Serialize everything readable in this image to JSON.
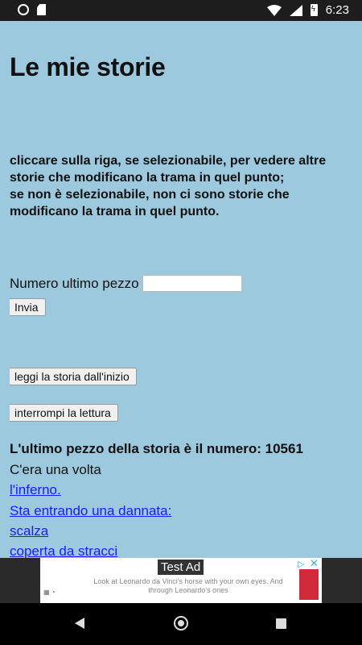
{
  "status": {
    "time": "6:23"
  },
  "page": {
    "title": "Le mie storie",
    "instructions": [
      "cliccare sulla riga, se selezionabile, per vedere altre storie che modificano la trama in quel punto;",
      "se non è selezionabile, non ci sono storie che modificano la trama in quel punto."
    ],
    "form": {
      "label": "Numero ultimo pezzo",
      "value": "",
      "submit": "Invia"
    },
    "buttons": {
      "start": "leggi la storia dall'inizio",
      "stop": "interrompi la lettura"
    },
    "last_piece": "L'ultimo pezzo della storia è il numero: 10561",
    "story": [
      {
        "text": "C'era una volta",
        "link": false
      },
      {
        "text": "l'inferno.",
        "link": true
      },
      {
        "text": "Sta entrando una dannata:",
        "link": true
      },
      {
        "text": "scalza",
        "link": true
      },
      {
        "text": "coperta da stracci",
        "link": true
      }
    ]
  },
  "ad": {
    "label": "Test Ad",
    "text": "Look at Leonardo da Vinci's horse with your own eyes. And through Leonardo's ones",
    "colors": {
      "choices": "#2ab5e6"
    }
  }
}
